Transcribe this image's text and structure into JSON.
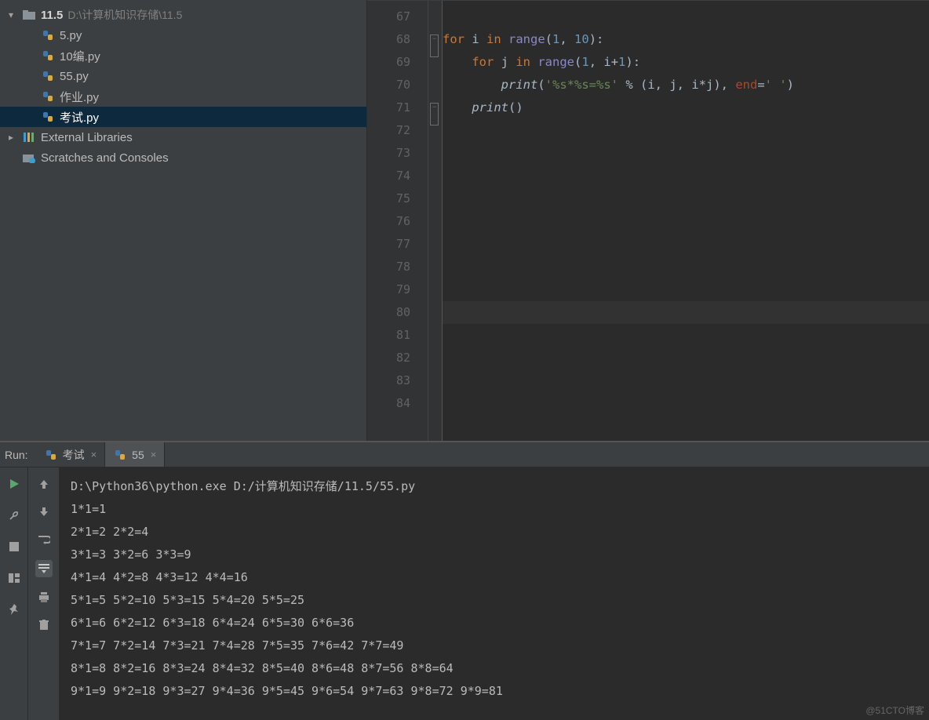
{
  "project": {
    "name": "11.5",
    "path": "D:\\计算机知识存储\\11.5",
    "files": [
      "5.py",
      "10编.py",
      "55.py",
      "作业.py",
      "考试.py"
    ],
    "selected": "考试.py",
    "external_libraries": "External Libraries",
    "scratches": "Scratches and Consoles"
  },
  "editor": {
    "gutter_start": 67,
    "gutter_end": 84,
    "code_lines": [
      "",
      "for i in range(1, 10):",
      "    for j in range(1, i+1):",
      "        print('%s*%s=%s' % (i, j, i*j), end=' ')",
      "    print()",
      "",
      "",
      "",
      "",
      "",
      "",
      "",
      "",
      "",
      "",
      "",
      "",
      ""
    ],
    "cursor_line": 80
  },
  "run": {
    "label": "Run:",
    "tabs": [
      {
        "name": "考试",
        "active": false
      },
      {
        "name": "55",
        "active": true
      }
    ],
    "output": [
      "D:\\Python36\\python.exe D:/计算机知识存储/11.5/55.py",
      "1*1=1",
      "2*1=2 2*2=4",
      "3*1=3 3*2=6 3*3=9",
      "4*1=4 4*2=8 4*3=12 4*4=16",
      "5*1=5 5*2=10 5*3=15 5*4=20 5*5=25",
      "6*1=6 6*2=12 6*3=18 6*4=24 6*5=30 6*6=36",
      "7*1=7 7*2=14 7*3=21 7*4=28 7*5=35 7*6=42 7*7=49",
      "8*1=8 8*2=16 8*3=24 8*4=32 8*5=40 8*6=48 8*7=56 8*8=64",
      "9*1=9 9*2=18 9*3=27 9*4=36 9*5=45 9*6=54 9*7=63 9*8=72 9*9=81"
    ]
  },
  "watermark": "@51CTO博客"
}
